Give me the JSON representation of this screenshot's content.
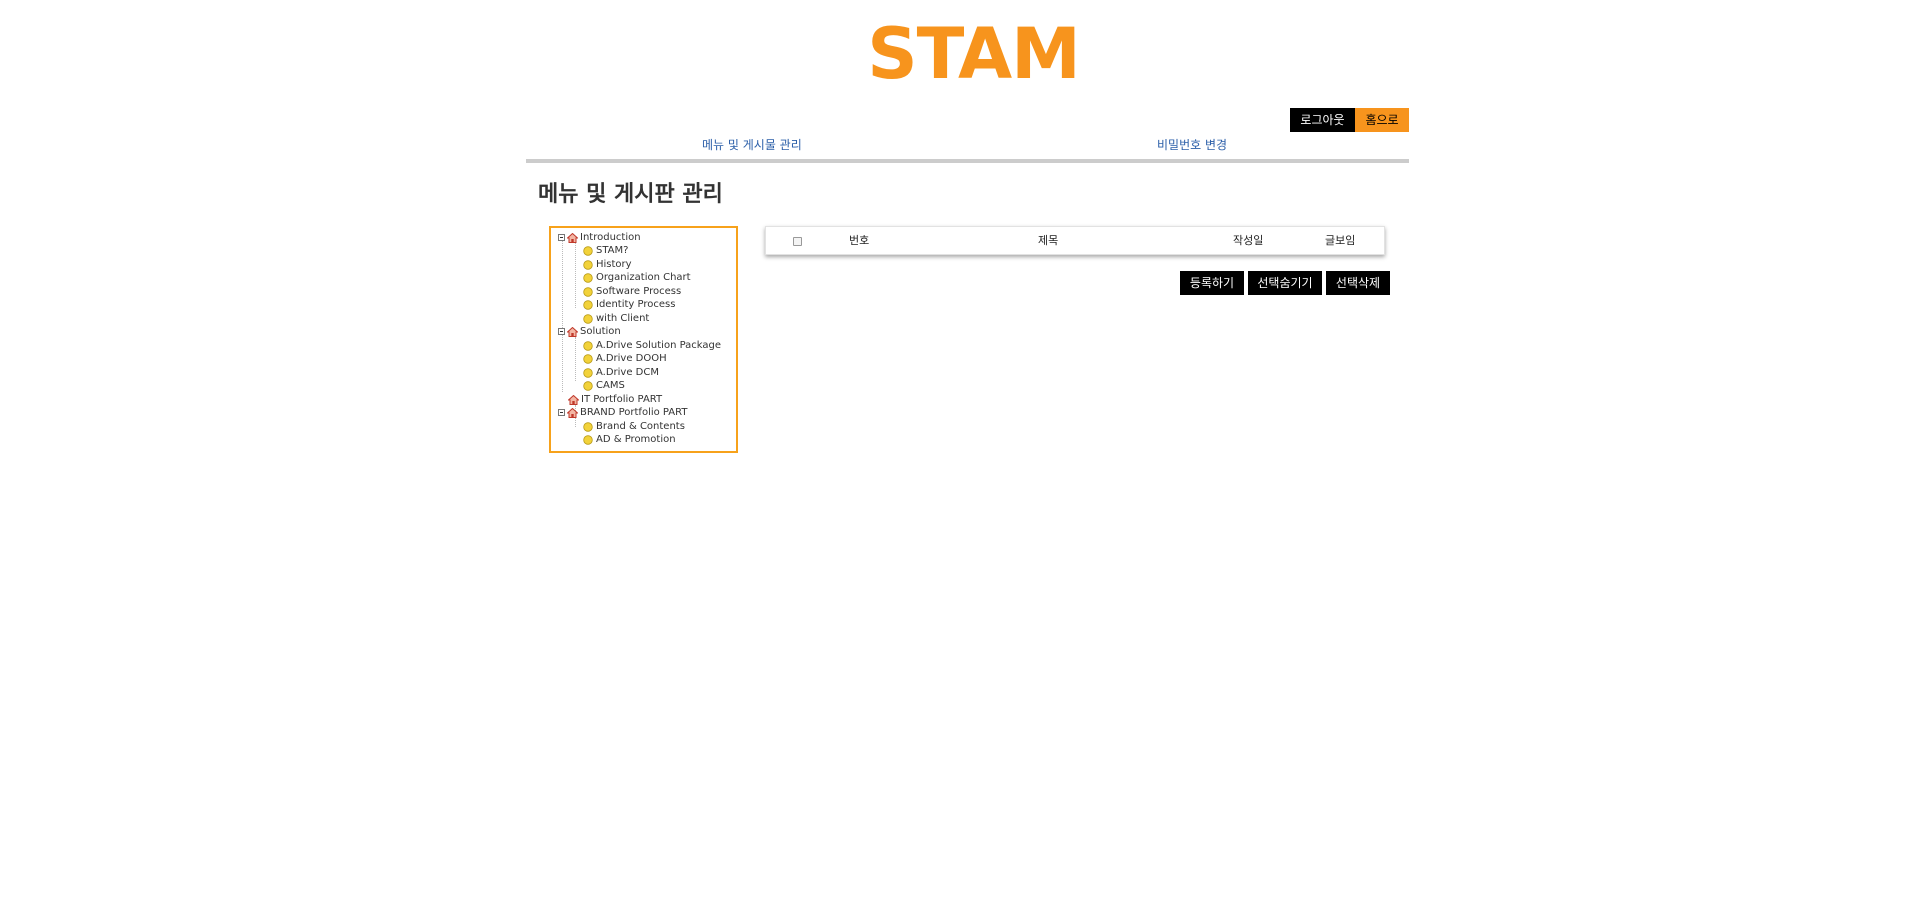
{
  "brand": {
    "logo_text": "STAM",
    "accent_color": "#f7941d"
  },
  "utility": {
    "logout_label": "로그아웃",
    "home_label": "홈으로"
  },
  "topnav": {
    "menu_board_label": "메뉴 및 게시물 관리",
    "password_label": "비밀번호 변경"
  },
  "page": {
    "title": "메뉴 및 게시판 관리"
  },
  "tree": {
    "groups": [
      {
        "label": "Introduction",
        "icon": "home-icon",
        "expanded": true,
        "items": [
          "STAM?",
          "History",
          "Organization Chart",
          "Software Process",
          "Identity Process",
          "with Client"
        ]
      },
      {
        "label": "Solution",
        "icon": "home-icon",
        "expanded": true,
        "items": [
          "A.Drive Solution Package",
          "A.Drive DOOH",
          "A.Drive DCM",
          "CAMS"
        ]
      },
      {
        "label": "IT Portfolio PART",
        "icon": "home-icon",
        "expanded": false,
        "items": []
      },
      {
        "label": "BRAND Portfolio PART",
        "icon": "home-icon",
        "expanded": true,
        "items": [
          "Brand & Contents",
          "AD & Promotion"
        ]
      }
    ],
    "leaf_icon": "circle-leaf-icon"
  },
  "board": {
    "columns": [
      "번호",
      "제목",
      "작성일",
      "글보임"
    ]
  },
  "actions": {
    "register_label": "등록하기",
    "hide_selected_label": "선택숨기기",
    "delete_selected_label": "선택삭제"
  }
}
